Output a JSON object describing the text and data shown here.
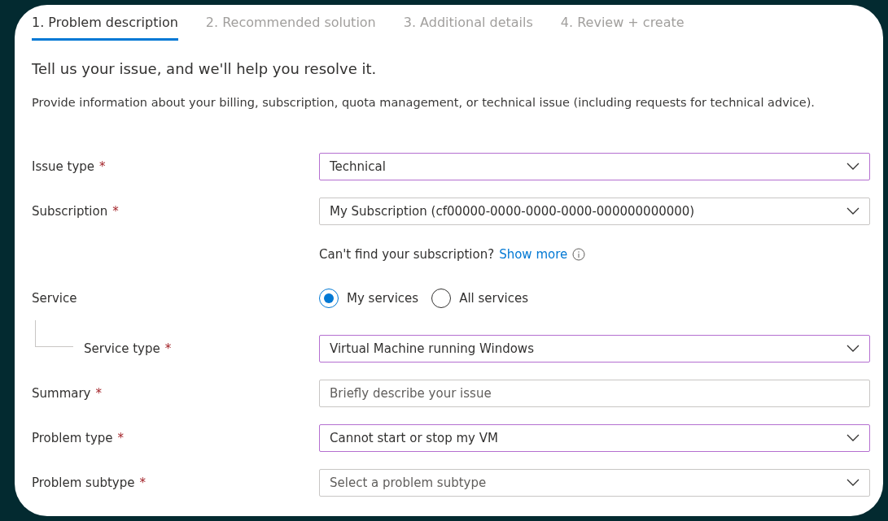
{
  "tabs": [
    {
      "label": "1. Problem description",
      "selected": true
    },
    {
      "label": "2. Recommended solution",
      "selected": false
    },
    {
      "label": "3. Additional details",
      "selected": false
    },
    {
      "label": "4. Review + create",
      "selected": false
    }
  ],
  "heading": "Tell us your issue, and we'll help you resolve it.",
  "description": "Provide information about your billing, subscription, quota management, or technical issue (including requests for technical advice).",
  "form": {
    "rows": [
      {
        "kind": "dropdown",
        "label": "Issue type",
        "required_mark": "*",
        "value": "Technical",
        "highlighted": true
      },
      {
        "kind": "dropdown",
        "label": "Subscription",
        "required_mark": "*",
        "value": "My Subscription (cf00000-0000-0000-0000-000000000000)",
        "highlighted": false
      },
      {
        "kind": "hint",
        "text": "Can't find your subscription?",
        "link": "Show more"
      },
      {
        "kind": "radio",
        "label": "Service",
        "options": [
          {
            "label": "My services",
            "selected": true
          },
          {
            "label": "All services",
            "selected": false
          }
        ]
      },
      {
        "kind": "dropdown",
        "label": "Service type",
        "required_mark": "*",
        "value": "Virtual Machine running Windows",
        "highlighted": true,
        "nested": true
      },
      {
        "kind": "text",
        "label": "Summary",
        "required_mark": "*",
        "placeholder": "Briefly describe your issue",
        "highlighted": false
      },
      {
        "kind": "dropdown",
        "label": "Problem type",
        "required_mark": "*",
        "value": "Cannot start or stop my VM",
        "highlighted": true
      },
      {
        "kind": "dropdown",
        "label": "Problem subtype",
        "required_mark": "*",
        "placeholder": "Select a problem subtype",
        "highlighted": false
      }
    ]
  }
}
